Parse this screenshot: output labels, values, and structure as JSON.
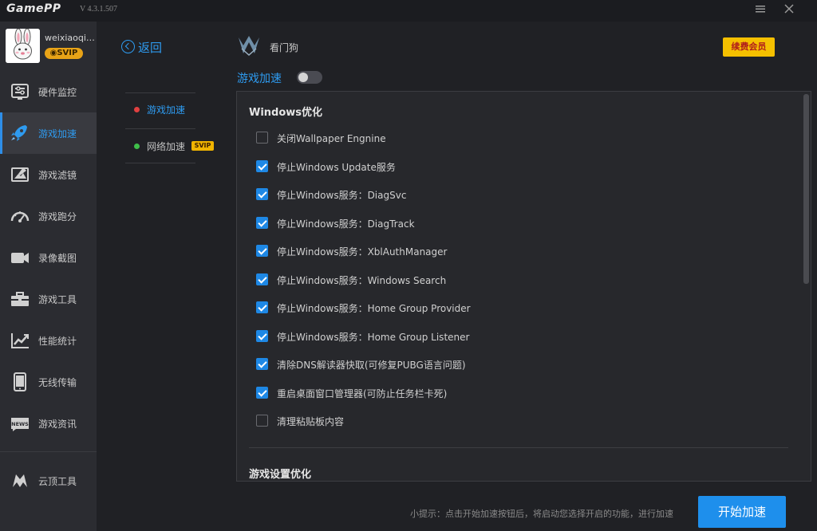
{
  "titlebar": {
    "app_name": "GamePP",
    "version": "V 4.3.1.507",
    "menu_icon": "menu-icon",
    "close_icon": "close-icon"
  },
  "user": {
    "name": "weixiaoqia...",
    "badge": "SVIP",
    "avatar_icon": "rabbit-avatar"
  },
  "sidebar": {
    "items": [
      {
        "label": "硬件监控",
        "icon": "hardware-monitor-icon"
      },
      {
        "label": "游戏加速",
        "icon": "rocket-icon"
      },
      {
        "label": "游戏滤镜",
        "icon": "filter-icon"
      },
      {
        "label": "游戏跑分",
        "icon": "speedometer-icon"
      },
      {
        "label": "录像截图",
        "icon": "camera-icon"
      },
      {
        "label": "游戏工具",
        "icon": "toolbox-icon"
      },
      {
        "label": "性能统计",
        "icon": "chart-icon"
      },
      {
        "label": "无线传输",
        "icon": "phone-icon"
      },
      {
        "label": "游戏资讯",
        "icon": "news-icon"
      }
    ],
    "active_index": 1,
    "cloud": {
      "label": "云顶工具",
      "icon": "cloud-top-icon"
    }
  },
  "subnav": {
    "back_label": "返回",
    "items": [
      {
        "label": "游戏加速",
        "dot_color": "#e04040",
        "active": true
      },
      {
        "label": "网络加速",
        "dot_color": "#3fbf4a",
        "tag": "SVIP"
      }
    ]
  },
  "header": {
    "watchdog_label": "看门狗",
    "renew_label": "续费会员",
    "accel_title": "游戏加速",
    "accel_enabled": false
  },
  "panel": {
    "section1_title": "Windows优化",
    "options": [
      {
        "label": "关闭Wallpaper Engnine",
        "checked": false
      },
      {
        "label": "停止Windows Update服务",
        "checked": true
      },
      {
        "label": "停止Windows服务：DiagSvc",
        "checked": true
      },
      {
        "label": "停止Windows服务：DiagTrack",
        "checked": true
      },
      {
        "label": "停止Windows服务：XblAuthManager",
        "checked": true
      },
      {
        "label": "停止Windows服务：Windows Search",
        "checked": true
      },
      {
        "label": "停止Windows服务：Home Group Provider",
        "checked": true
      },
      {
        "label": "停止Windows服务：Home Group Listener",
        "checked": true
      },
      {
        "label": "清除DNS解读器快取(可修复PUBG语言问题)",
        "checked": true
      },
      {
        "label": "重启桌面窗口管理器(可防止任务栏卡死)",
        "checked": true
      },
      {
        "label": "清理粘贴板内容",
        "checked": false
      }
    ],
    "section2_title": "游戏设置优化"
  },
  "footer": {
    "tip": "小提示：点击开始加速按钮后，将启动您选择开启的功能，进行加速",
    "start_label": "开始加速"
  },
  "colors": {
    "accent": "#2e9bf0",
    "checkbox": "#1e88e5",
    "renew_bg": "#f5c000",
    "svip": "#e8a317"
  }
}
